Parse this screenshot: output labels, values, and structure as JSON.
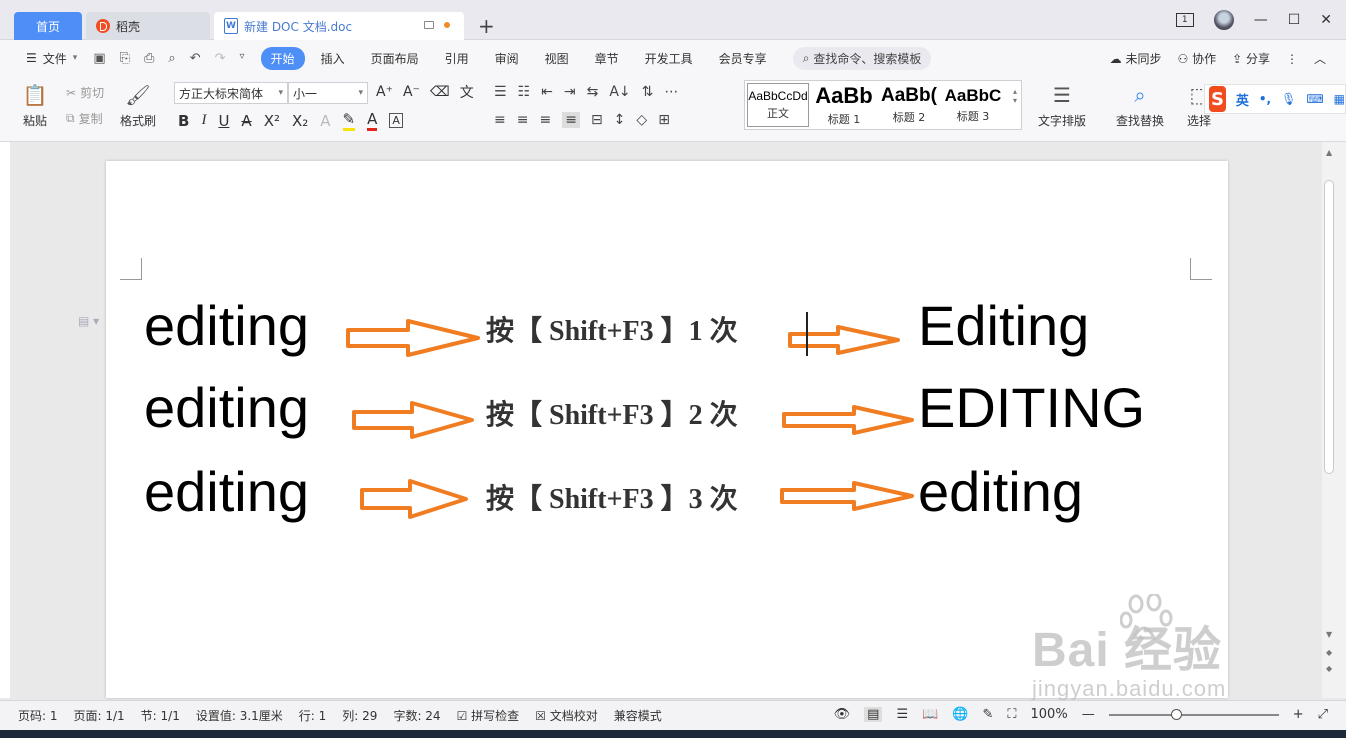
{
  "tabs": {
    "home": "首页",
    "daoke": "稻壳",
    "doc": "新建 DOC 文档.doc",
    "new_tab": "+"
  },
  "window": {
    "page_indicator": "1",
    "minimize": "—",
    "restore": "☐",
    "close": "✕"
  },
  "menu": {
    "file": "文件",
    "items": [
      "开始",
      "插入",
      "页面布局",
      "引用",
      "审阅",
      "视图",
      "章节",
      "开发工具",
      "会员专享"
    ],
    "search_placeholder": "查找命令、搜索模板",
    "right": [
      "未同步",
      "协作",
      "分享"
    ]
  },
  "ribbon": {
    "paste": "粘贴",
    "cut": "剪切",
    "copy": "复制",
    "format_painter": "格式刷",
    "font_name": "方正大标宋简体",
    "font_size": "小一",
    "styles": [
      {
        "preview": "AaBbCcDd",
        "name": "正文"
      },
      {
        "preview": "AaBb",
        "name": "标题 1"
      },
      {
        "preview": "AaBb(",
        "name": "标题 2"
      },
      {
        "preview": "AaBbC",
        "name": "标题 3"
      }
    ],
    "text_layout": "文字排版",
    "find_replace": "查找替换",
    "select": "选择"
  },
  "ime": {
    "logo": "S",
    "lang": "英"
  },
  "document": {
    "rows": [
      {
        "source": "editing",
        "instruction": "按【 Shift+F3 】1 次",
        "result": "Editing"
      },
      {
        "source": "editing",
        "instruction": "按【 Shift+F3 】2 次",
        "result": "EDITING"
      },
      {
        "source": "editing",
        "instruction": "按【 Shift+F3 】3 次",
        "result": "editing"
      }
    ],
    "arrow_color": "#f07d22"
  },
  "watermark": {
    "brand": "Bai  经验",
    "url": "jingyan.baidu.com"
  },
  "status": {
    "items": [
      "页码: 1",
      "页面: 1/1",
      "节: 1/1",
      "设置值: 3.1厘米",
      "行: 1",
      "列: 29",
      "字数: 24",
      "拼写检查",
      "文档校对",
      "兼容模式"
    ],
    "zoom": "100%"
  }
}
